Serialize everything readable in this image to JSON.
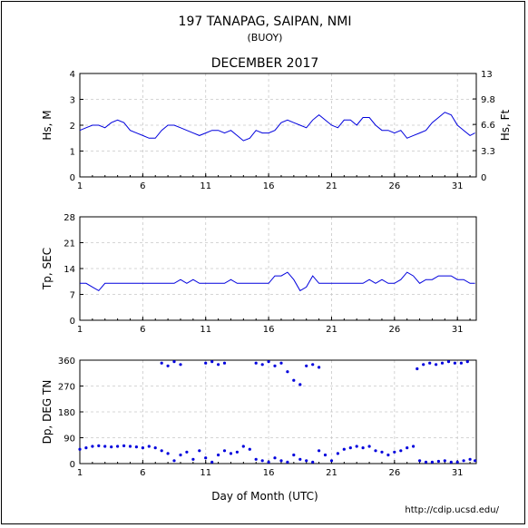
{
  "header": {
    "station": "197 TANAPAG, SAIPAN, NMI",
    "platform": "(BUOY)",
    "period": "DECEMBER 2017"
  },
  "footer": {
    "xlabel": "Day of Month (UTC)",
    "url": "http://cdip.ucsd.edu/"
  },
  "colors": {
    "series": "#0000dd",
    "grid": "#c8c8c8"
  },
  "chart_data": [
    {
      "type": "line",
      "ylabel": "Hs, M",
      "ylabel_right": "Hs, Ft",
      "ylim": [
        0,
        4
      ],
      "yticks": [
        "0",
        "1",
        "2",
        "3",
        "4"
      ],
      "ylim_right": [
        0,
        13
      ],
      "yticks_right": [
        "0",
        "3.3",
        "6.6",
        "9.8",
        "13"
      ],
      "xlim": [
        1,
        32.5
      ],
      "xticks": [
        "1",
        "6",
        "11",
        "16",
        "21",
        "26",
        "31"
      ],
      "grid": true,
      "series": [
        {
          "x": [
            1,
            1.5,
            2,
            2.5,
            3,
            3.5,
            4,
            4.5,
            5,
            5.5,
            6,
            6.5,
            7,
            7.5,
            8,
            8.5,
            9,
            9.5,
            10,
            10.5,
            11,
            11.5,
            12,
            12.5,
            13,
            13.5,
            14,
            14.5,
            15,
            15.5,
            16,
            16.5,
            17,
            17.5,
            18,
            18.5,
            19,
            19.5,
            20,
            20.5,
            21,
            21.5,
            22,
            22.5,
            23,
            23.5,
            24,
            24.5,
            25,
            25.5,
            26,
            26.5,
            27,
            27.5,
            28,
            28.5,
            29,
            29.5,
            30,
            30.5,
            31,
            31.5,
            32,
            32.4
          ],
          "values": [
            1.8,
            1.9,
            2.0,
            2.0,
            1.9,
            2.1,
            2.2,
            2.1,
            1.8,
            1.7,
            1.6,
            1.5,
            1.5,
            1.8,
            2.0,
            2.0,
            1.9,
            1.8,
            1.7,
            1.6,
            1.7,
            1.8,
            1.8,
            1.7,
            1.8,
            1.6,
            1.4,
            1.5,
            1.8,
            1.7,
            1.7,
            1.8,
            2.1,
            2.2,
            2.1,
            2.0,
            1.9,
            2.2,
            2.4,
            2.2,
            2.0,
            1.9,
            2.2,
            2.2,
            2.0,
            2.3,
            2.3,
            2.0,
            1.8,
            1.8,
            1.7,
            1.8,
            1.5,
            1.6,
            1.7,
            1.8,
            2.1,
            2.3,
            2.5,
            2.4,
            2.0,
            1.8,
            1.6,
            1.7
          ]
        }
      ]
    },
    {
      "type": "line",
      "ylabel": "Tp, SEC",
      "ylim": [
        0,
        28
      ],
      "yticks": [
        "0",
        "7",
        "14",
        "21",
        "28"
      ],
      "xlim": [
        1,
        32.5
      ],
      "xticks": [
        "1",
        "6",
        "11",
        "16",
        "21",
        "26",
        "31"
      ],
      "grid": true,
      "series": [
        {
          "x": [
            1,
            1.5,
            2,
            2.5,
            3,
            3.5,
            4,
            4.5,
            5,
            5.5,
            6,
            6.5,
            7,
            7.5,
            8,
            8.5,
            9,
            9.5,
            10,
            10.5,
            11,
            11.5,
            12,
            12.5,
            13,
            13.5,
            14,
            14.5,
            15,
            15.5,
            16,
            16.5,
            17,
            17.5,
            18,
            18.5,
            19,
            19.5,
            20,
            20.5,
            21,
            21.5,
            22,
            22.5,
            23,
            23.5,
            24,
            24.5,
            25,
            25.5,
            26,
            26.5,
            27,
            27.5,
            28,
            28.5,
            29,
            29.5,
            30,
            30.5,
            31,
            31.5,
            32,
            32.4
          ],
          "values": [
            10,
            10,
            9,
            8,
            10,
            10,
            10,
            10,
            10,
            10,
            10,
            10,
            10,
            10,
            10,
            10,
            11,
            10,
            11,
            10,
            10,
            10,
            10,
            10,
            11,
            10,
            10,
            10,
            10,
            10,
            10,
            12,
            12,
            13,
            11,
            8,
            9,
            12,
            10,
            10,
            10,
            10,
            10,
            10,
            10,
            10,
            11,
            10,
            11,
            10,
            10,
            11,
            13,
            12,
            10,
            11,
            11,
            12,
            12,
            12,
            11,
            11,
            10,
            10
          ]
        }
      ]
    },
    {
      "type": "scatter",
      "ylabel": "Dp, DEG TN",
      "ylim": [
        0,
        360
      ],
      "yticks": [
        "0",
        "90",
        "180",
        "270",
        "360"
      ],
      "xlim": [
        1,
        32.5
      ],
      "xticks": [
        "1",
        "6",
        "11",
        "16",
        "21",
        "26",
        "31"
      ],
      "grid": true,
      "series": [
        {
          "x": [
            1,
            1.5,
            2,
            2.5,
            3,
            3.5,
            4,
            4.5,
            5,
            5.5,
            6,
            6.5,
            7,
            7.5,
            8,
            8.5,
            9,
            9.5,
            10,
            10.5,
            11,
            11.5,
            12,
            12.5,
            13,
            13.5,
            14,
            14.5,
            15,
            15.5,
            16,
            16.5,
            17,
            17.5,
            18,
            18.5,
            19,
            19.5,
            20,
            20.5,
            21,
            21.5,
            22,
            22.5,
            23,
            23.5,
            24,
            24.5,
            25,
            25.5,
            26,
            26.5,
            27,
            27.5,
            28,
            28.5,
            29,
            29.5,
            30,
            30.5,
            31,
            31.5,
            32,
            32.4,
            7.5,
            8,
            8.5,
            9,
            11,
            11.5,
            12,
            12.5,
            15,
            15.5,
            16,
            16.5,
            17,
            17.5,
            18,
            18.5,
            19,
            19.5,
            20,
            27.8,
            28.3,
            28.8,
            29.3,
            29.8,
            30.3,
            30.8,
            31.3,
            31.8
          ],
          "values": [
            50,
            55,
            60,
            62,
            60,
            58,
            60,
            62,
            60,
            58,
            55,
            60,
            55,
            45,
            35,
            10,
            30,
            40,
            15,
            45,
            20,
            5,
            30,
            45,
            35,
            40,
            60,
            50,
            15,
            10,
            5,
            20,
            10,
            5,
            30,
            15,
            10,
            5,
            45,
            30,
            10,
            35,
            50,
            55,
            60,
            55,
            60,
            45,
            40,
            30,
            40,
            45,
            55,
            60,
            10,
            5,
            5,
            8,
            10,
            5,
            5,
            10,
            15,
            10,
            350,
            340,
            355,
            345,
            350,
            355,
            345,
            350,
            350,
            345,
            355,
            340,
            350,
            320,
            290,
            275,
            340,
            345,
            335,
            330,
            345,
            350,
            345,
            350,
            355,
            350,
            350,
            355
          ]
        }
      ]
    }
  ]
}
